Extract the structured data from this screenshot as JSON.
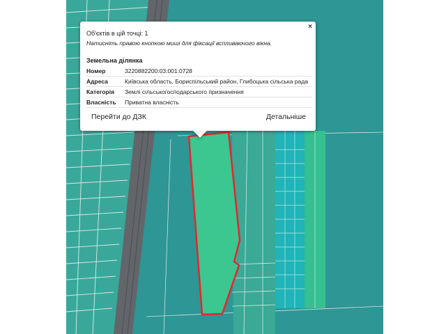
{
  "colors": {
    "parcel_fill": "#3cc690",
    "parcel_outline": "#e8252c",
    "land_teal": "#2ea79c",
    "road_gray": "#62666a"
  },
  "popup": {
    "count_text": "Об'єктів в цій точці: 1",
    "hint_text": "Натисніть правою кнопкою миші для фіксації вспливаючого вікна.",
    "close_icon": "×",
    "section_title": "Земельна ділянка",
    "rows": [
      {
        "key": "Номер",
        "value": "3220882200:03:001:0728"
      },
      {
        "key": "Адреса",
        "value": "Київська область, Бориспільський район, Глибоцька сільська рада"
      },
      {
        "key": "Категорія",
        "value": "Землі сільськогосподарського призначення"
      },
      {
        "key": "Власність",
        "value": "Приватна власність"
      }
    ],
    "goto_label": "Перейти до ДЗК",
    "details_label": "Детальніше"
  }
}
